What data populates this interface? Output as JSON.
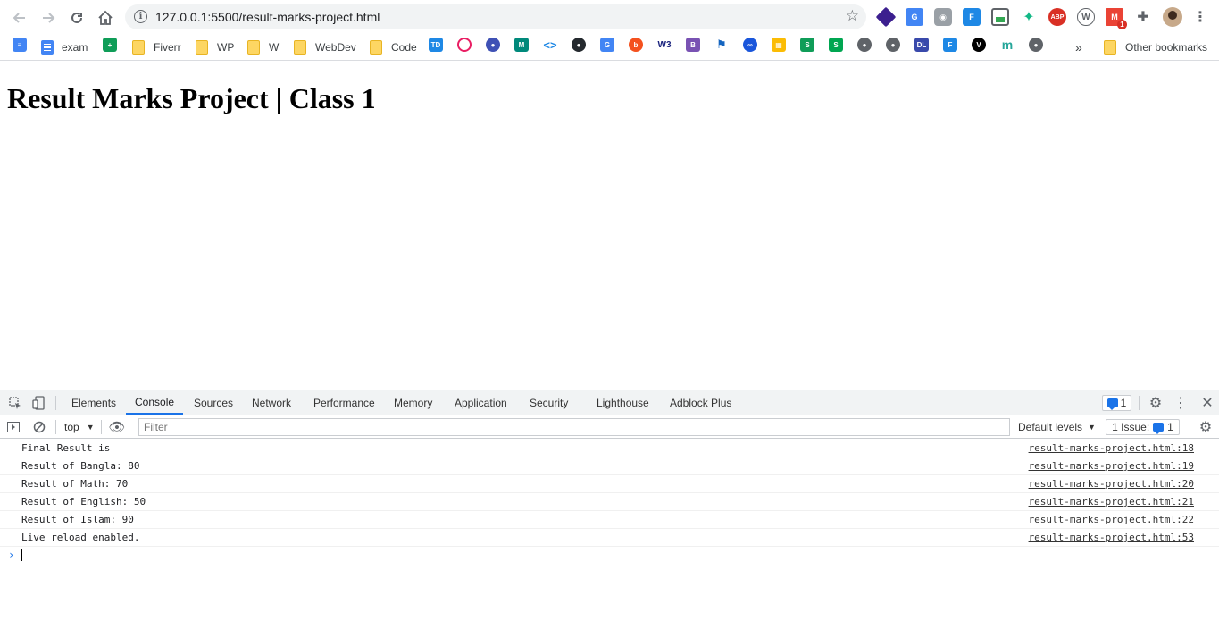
{
  "browser": {
    "url": "127.0.0.1:5500/result-marks-project.html",
    "extensions": [
      "layers-ext-icon",
      "google-translate-icon",
      "camera-icon",
      "font-ext-icon",
      "image-ext-icon",
      "bird-ext-icon",
      "adblock-plus-icon",
      "wordpress-icon",
      "gmail-icon",
      "puzzle-icon",
      "profile-avatar",
      "menu-dots-icon"
    ],
    "gmail_badge": "1"
  },
  "bookmarks": {
    "items": [
      {
        "label": "exam",
        "kind": "doc"
      },
      {
        "label": "Fiverr",
        "kind": "folder"
      },
      {
        "label": "WP",
        "kind": "folder"
      },
      {
        "label": "W",
        "kind": "folder"
      },
      {
        "label": "WebDev",
        "kind": "folder"
      },
      {
        "label": "Code",
        "kind": "folder"
      }
    ],
    "overflow": "»",
    "other": "Other bookmarks"
  },
  "page": {
    "title": "Result Marks Project | Class 1"
  },
  "devtools": {
    "tabs": [
      "Elements",
      "Console",
      "Sources",
      "Network",
      "Performance",
      "Memory",
      "Application",
      "Security",
      "Lighthouse",
      "Adblock Plus"
    ],
    "active_tab": "Console",
    "issues_count": "1",
    "context": "top",
    "filter_placeholder": "Filter",
    "levels": "Default levels",
    "issues_label": "1 Issue:",
    "issues_label_count": "1",
    "logs": [
      {
        "message": "Final Result is",
        "source": "result-marks-project.html:18"
      },
      {
        "message": "Result of Bangla: 80",
        "source": "result-marks-project.html:19"
      },
      {
        "message": "Result of Math: 70",
        "source": "result-marks-project.html:20"
      },
      {
        "message": "Result of English: 50",
        "source": "result-marks-project.html:21"
      },
      {
        "message": "Result of Islam: 90",
        "source": "result-marks-project.html:22"
      },
      {
        "message": "Live reload enabled.",
        "source": "result-marks-project.html:53"
      }
    ]
  },
  "colors": {
    "accent": "#1a73e8",
    "folder": "#fdd663"
  }
}
